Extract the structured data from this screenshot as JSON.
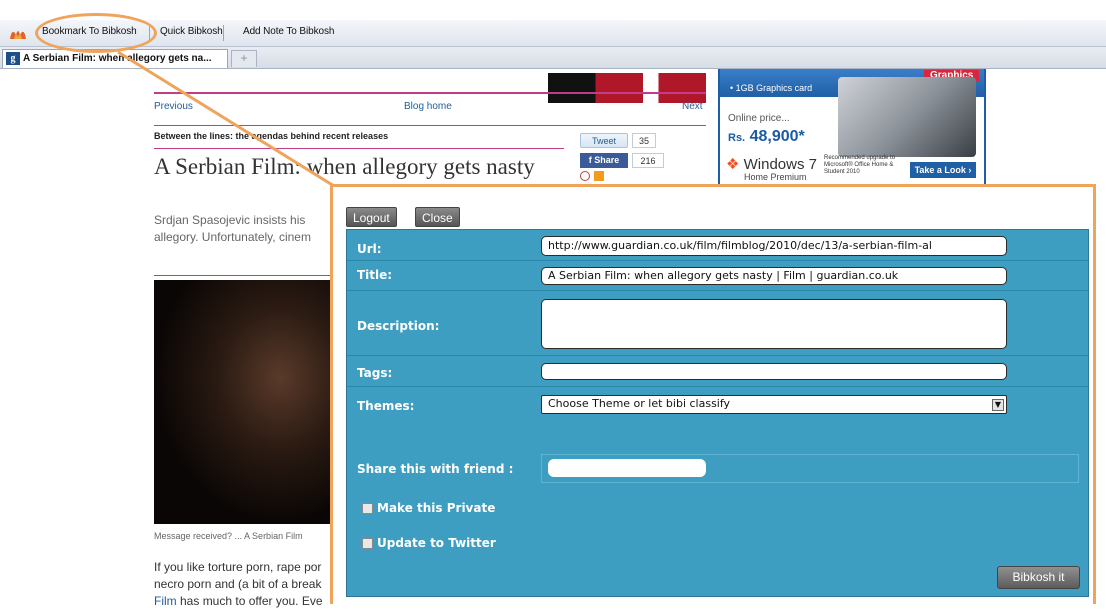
{
  "toolbar": {
    "buttons": [
      "Bookmark To Bibkosh",
      "Quick Bibkosh",
      "Add Note To Bibkosh"
    ]
  },
  "tabs": {
    "active_title": "A Serbian Film: when allegory gets na...",
    "new_tab_symbol": "+"
  },
  "article": {
    "nav_prev": "Previous",
    "nav_home": "Blog home",
    "nav_next": "Next",
    "series": "Between the lines: the agendas behind recent releases",
    "headline": "A Serbian Film: when allegory gets nasty",
    "standfirst": "Srdjan Spasojevic insists his allegory. Unfortunately, cinem",
    "tweet_label": "Tweet",
    "tweet_count": "35",
    "share_label": "Share",
    "share_count": "216",
    "caption": "Message received? ... A Serbian Film",
    "body_1": "If you like torture porn, rape por necro porn and (a bit of a break",
    "body_link": "Film",
    "body_2": " has much to offer you. Eve"
  },
  "ad": {
    "spec_line": "• 1GB Graphics card",
    "graphics_badge": "Graphics",
    "online_price": "Online price...",
    "price_prefix": "Rs.",
    "price": "48,900*",
    "windows": "Windows 7",
    "windows_sub": "Home Premium",
    "recommended": "Recommended upgrade to Microsoft® Office Home & Student 2010",
    "cta": "Take a Look ›"
  },
  "bibkosh": {
    "logout": "Logout",
    "close": "Close",
    "url_label": "Url:",
    "url_value": "http://www.guardian.co.uk/film/filmblog/2010/dec/13/a-serbian-film-al",
    "title_label": "Title:",
    "title_value": "A Serbian Film: when allegory gets nasty | Film | guardian.co.uk",
    "description_label": "Description:",
    "description_value": "",
    "tags_label": "Tags:",
    "tags_value": "",
    "themes_label": "Themes:",
    "themes_value": "Choose Theme or let bibi classify",
    "share_label": "Share this with friend :",
    "share_value": "",
    "private_label": "Make this Private",
    "private_checked": false,
    "twitter_label": "Update to Twitter",
    "twitter_checked": false,
    "submit": "Bibkosh it"
  },
  "colors": {
    "form_bg": "#3e9ec1",
    "highlight": "#f0a35a",
    "guardian_pink": "#c03d8c"
  }
}
